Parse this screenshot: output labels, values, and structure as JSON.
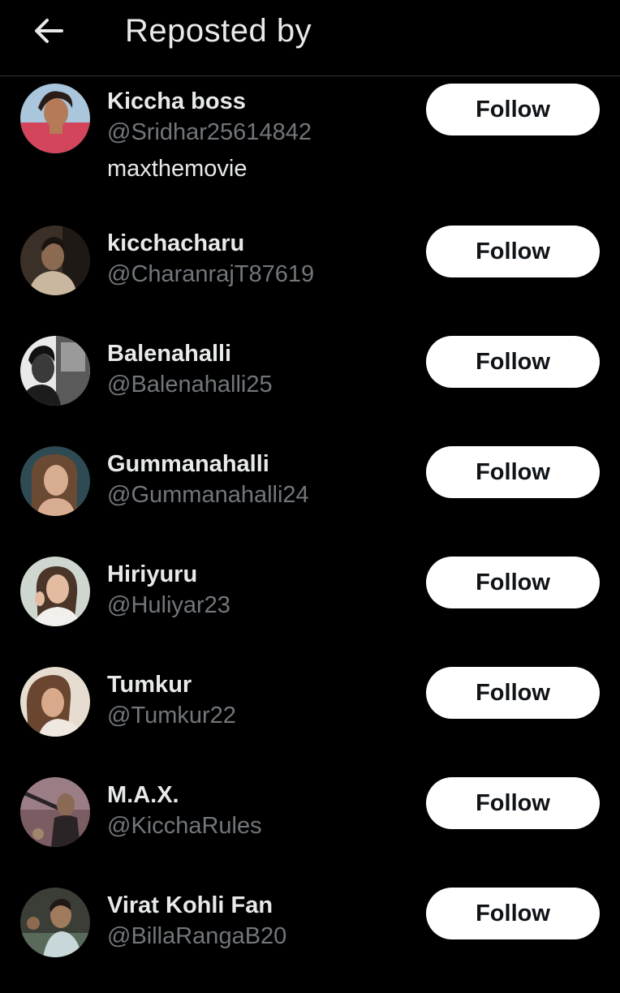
{
  "header": {
    "title": "Reposted by",
    "back_icon": "arrow-left-icon"
  },
  "users": [
    {
      "name": "Kiccha boss",
      "handle": "@Sridhar25614842",
      "bio": "maxthemovie",
      "follow_label": "Follow"
    },
    {
      "name": "kicchacharu",
      "handle": "@CharanrajT87619",
      "follow_label": "Follow"
    },
    {
      "name": "Balenahalli",
      "handle": "@Balenahalli25",
      "follow_label": "Follow"
    },
    {
      "name": "Gummanahalli",
      "handle": "@Gummanahalli24",
      "follow_label": "Follow"
    },
    {
      "name": "Hiriyuru",
      "handle": "@Huliyar23",
      "follow_label": "Follow"
    },
    {
      "name": "Tumkur",
      "handle": "@Tumkur22",
      "follow_label": "Follow"
    },
    {
      "name": "M.A.X.",
      "handle": "@KicchaRules",
      "follow_label": "Follow"
    },
    {
      "name": "Virat Kohli Fan",
      "handle": "@BillaRangaB20",
      "follow_label": "Follow"
    }
  ],
  "colors": {
    "background": "#000000",
    "primary_text": "#e7e9ea",
    "secondary_text": "#71767b",
    "button_bg": "#ffffff",
    "button_text": "#0f1419"
  }
}
